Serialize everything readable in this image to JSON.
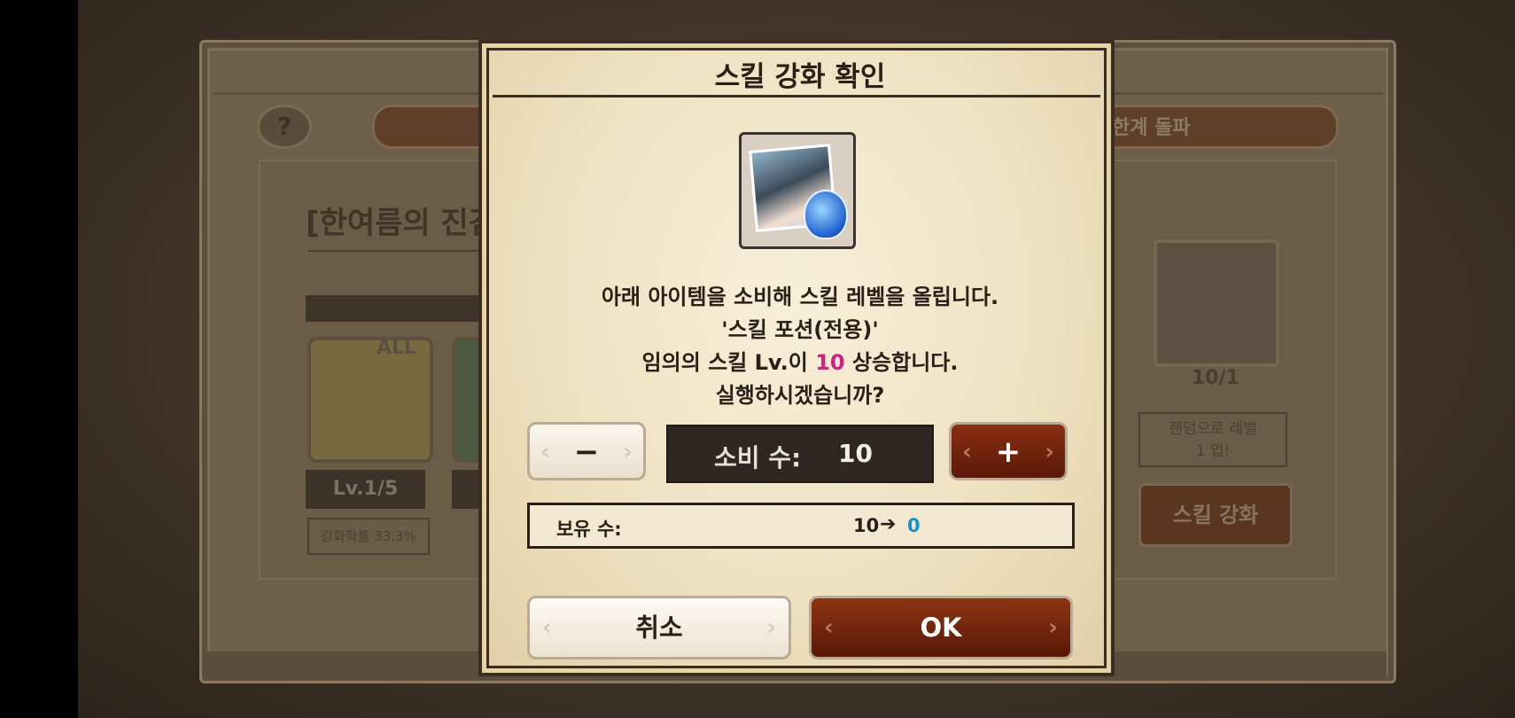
{
  "background": {
    "help_label": "?",
    "tab_label": "한계 돌파",
    "event_title": "[한여름의 진검",
    "all_tag": "ALL",
    "level": "Lv.1/5",
    "rate": "강화확률 33.3%",
    "owned_count": "10/1",
    "random_level_line1": "랜덤으로 레벨",
    "random_level_line2": "1 업!",
    "skill_upgrade_button": "스킬 강화"
  },
  "dialog": {
    "title": "스킬 강화 확인",
    "item_icon": "skill-potion-icon",
    "line1": "아래 아이템을 소비해 스킬 레벨을 올립니다.",
    "line2": "'스킬 포션(전용)'",
    "line3_prefix": "임의의 스킬 Lv.이 ",
    "line3_value": "10",
    "line3_suffix": " 상승합니다.",
    "line4": "실행하시겠습니까?",
    "minus_label": "−",
    "plus_label": "+",
    "cost_label": "소비 수:",
    "cost_value": "10",
    "owned_label": "보유 수:",
    "owned_from": "10",
    "owned_arrow": "➔",
    "owned_to": "0",
    "cancel_label": "취소",
    "ok_label": "OK"
  },
  "colors": {
    "highlight": "#d02080",
    "owned_to": "#1a8fc4",
    "ok_button": "#8e3413"
  }
}
